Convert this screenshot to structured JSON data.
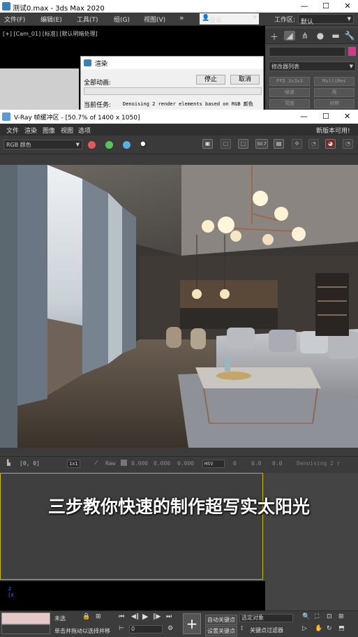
{
  "max_window": {
    "title": "测试0.max - 3ds Max 2020",
    "controls": {
      "minimize": "—",
      "maximize": "☐",
      "close": "✕"
    }
  },
  "max_menu": {
    "items": [
      "文件(F)",
      "编辑(E)",
      "工具(T)",
      "组(G)",
      "视图(V)",
      "»"
    ],
    "login": "登录",
    "workspace_label": "工作区:",
    "workspace_value": "默认"
  },
  "viewport": {
    "label": "[+] [Cam_01] [标准] [默认明暗处理]"
  },
  "command_panel": {
    "modifier_list": "修改器列表",
    "modifier_buttons": [
      "FFD 3x3x3",
      "MultiRes",
      "噪波",
      "壳",
      "弯曲",
      "对称"
    ]
  },
  "render_dialog": {
    "title": "渲染",
    "all_animation": "全部动画:",
    "stop": "停止",
    "cancel": "取消",
    "current_task_label": "当前任务:",
    "current_task_value": "Denoising 2 render elements based on RGB 颜色"
  },
  "vfb": {
    "title": "V-Ray 帧缓冲区 - [50.7% of 1400 x 1050]",
    "menu": [
      "文件",
      "渲染",
      "图像",
      "视图",
      "选项"
    ],
    "update_notice": "新版本可用!",
    "channel": "RGB 颜色",
    "zoom": "50.7",
    "status": {
      "coords": "[0, 0]",
      "sample": "1x1",
      "raw_label": "Raw",
      "rgb": [
        "0.000",
        "0.000",
        "0.000"
      ],
      "mode": "HSV",
      "hsv": [
        "0",
        "0.0",
        "0.0"
      ],
      "task": "Denoising 2 r"
    },
    "colors": {
      "red": "#e05a5a",
      "green": "#5ac45a",
      "blue": "#5ab0e0"
    }
  },
  "caption": "三步教你快速的制作超写实太阳光",
  "bottom_bar": {
    "unselected": "未选",
    "hint": "单击并拖动以选择并移",
    "auto_key": "自动关键点",
    "set_key": "设置关键点",
    "selected_object": "选定对象",
    "key_filter": "关键点过滤器",
    "frame": "0"
  }
}
